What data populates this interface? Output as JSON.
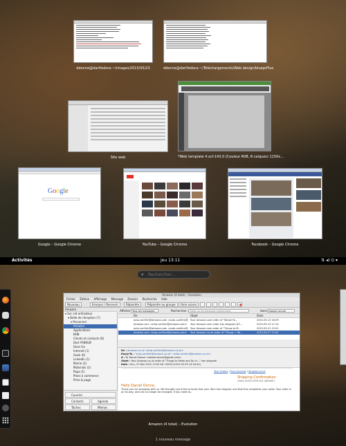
{
  "overview": {
    "windows": [
      {
        "caption": "ddonne@dartfedora:~/images/2015/05/23",
        "kind": "terminal"
      },
      {
        "caption": "ddonne@dartfedora:~/Téléchargements/Web design/blueprPlus",
        "kind": "terminal"
      },
      {
        "caption": "Site web",
        "kind": "filemanager"
      },
      {
        "caption": "*Web template 4.xcf-143.0 (Couleur RVB, 8 calques) 1150x...",
        "kind": "gimp"
      },
      {
        "caption": "Google – Google Chrome",
        "kind": "google"
      },
      {
        "caption": "YouTube – Google Chrome",
        "kind": "youtube"
      },
      {
        "caption": "Facebook – Google Chrome",
        "kind": "facebook"
      }
    ]
  },
  "topbar": {
    "activities": "Activités",
    "clock": "jeu 13:11",
    "system_icons": "⇅ ◂) ⏻ ▾"
  },
  "search": {
    "placeholder": "Rechercher…"
  },
  "dash": {
    "apps": [
      "firefox-icon",
      "nautilus-icon",
      "chrome-icon",
      "terminal-icon",
      "thunderbird-icon",
      "text-editor-icon",
      "software-icon",
      "settings-icon",
      "show-apps-icon"
    ]
  },
  "thunderbird": {
    "title": "Amazon (4 total) – Evolution",
    "menu": [
      "Fichier",
      "Édition",
      "Affichage",
      "Message",
      "Dossier",
      "Recherche",
      "Aide"
    ],
    "toolbar": {
      "new": "Nouveau",
      "send_receive": "Envoyer / Recevoir",
      "reply": "Répondre",
      "reply_group": "Répondre au groupe",
      "forward": "Faire suivre"
    },
    "folder_header": "Amazon",
    "folders": [
      {
        "label": "▾ Sur cet ordinateur",
        "indent": 0,
        "selected": false
      },
      {
        "label": "▾ Boîte de réception (7)",
        "indent": 1,
        "selected": false
      },
      {
        "label": "▾ Personnel",
        "indent": 2,
        "selected": false
      },
      {
        "label": "Amazon",
        "indent": 3,
        "selected": true
      },
      {
        "label": "Applications",
        "indent": 3,
        "selected": false
      },
      {
        "label": "BHB",
        "indent": 3,
        "selected": false
      },
      {
        "label": "Clients et contacts (8)",
        "indent": 3,
        "selected": false
      },
      {
        "label": "Dart FANSUB",
        "indent": 3,
        "selected": false
      },
      {
        "label": "Dons Go",
        "indent": 3,
        "selected": false
      },
      {
        "label": "Internet (1)",
        "indent": 3,
        "selected": false
      },
      {
        "label": "Geek (6)",
        "indent": 3,
        "selected": false
      },
      {
        "label": "LinkedIn (1)",
        "indent": 3,
        "selected": false
      },
      {
        "label": "Mairie (2)",
        "indent": 3,
        "selected": false
      },
      {
        "label": "Materials (1)",
        "indent": 3,
        "selected": false
      },
      {
        "label": "Papa (1)",
        "indent": 3,
        "selected": false
      },
      {
        "label": "Plans à commerce",
        "indent": 3,
        "selected": false
      },
      {
        "label": "Prise & page",
        "indent": 3,
        "selected": false
      }
    ],
    "bottom_buttons": {
      "mail": "Courriel",
      "contacts": "Contacts",
      "calendar": "Agenda",
      "tasks": "Tâches",
      "memos": "Mémos"
    },
    "filter": {
      "show_label": "Afficher :",
      "show_value": "Tous les messages",
      "search_label": "Rechercher :",
      "search_placeholder": "Objet ou les adresses contiennent",
      "in_label": "dans",
      "in_value": "Dossier actuel"
    },
    "list_headers": {
      "from": "De",
      "subject": "Objet",
      "date": "Date"
    },
    "messages": [
      {
        "from": "auto-confirm@amazon.com <auto-confirm@...>",
        "subject": "Your Amazon.com order of \"Nicole Fo...",
        "date": "2015-05-13 16:09",
        "selected": false
      },
      {
        "from": "Amazon.com <ship-confirm@amazon.com>",
        "subject": "Your Amazon.com order has shipped (#3...",
        "date": "2015-05-13 17:14",
        "selected": false
      },
      {
        "from": "auto-confirm@amazon.com <auto-confirm@...>",
        "subject": "Your Amazon.com order of \"Things to M...",
        "date": "2015-05-21 15:01",
        "selected": false
      },
      {
        "from": "Amazon.com <ship-confirm@amazon.com>",
        "subject": "Your Amazon.co.uk order of \"Things + Rb...",
        "date": "2015-05-27 13:02",
        "selected": true
      }
    ],
    "headers": {
      "from_label": "De :",
      "from_value": "Amazon.co.uk <ship-confirm@amazon.co.uk>",
      "replyto_label": "Reply-To :",
      "replyto_value": "\"ship-confirm@amazon.co.uk\" <ship-confirm@amazon.co.uk>",
      "to_label": "À :",
      "to_value": "Dr Daniel Donne <daniel.donne@gmail.com>",
      "subject_label": "Objet :",
      "subject_value": "Your Amazon.co.uk order of \"Things to Make and Do in...\" has shipped!",
      "date_label": "Date :",
      "date_value": "Sun, 27 Mar 2015 13:02:46 +0000 (2015-03-29 14:18:44)"
    },
    "body": {
      "nav": [
        "Your Orders",
        "Your Account",
        "Amazon.co.uk"
      ],
      "confirm_title": "Shipping Confirmation",
      "order": "Order #202-5391323-2826057",
      "greeting": "Hello Daniel Donne,",
      "text": "Thank you for shopping with us. We thought you'd like to know that your item has shipped, and that this completes your order. Your order is on its way, and can no longer be changed. If you need to..."
    }
  },
  "notification": "1 nouveau message"
}
